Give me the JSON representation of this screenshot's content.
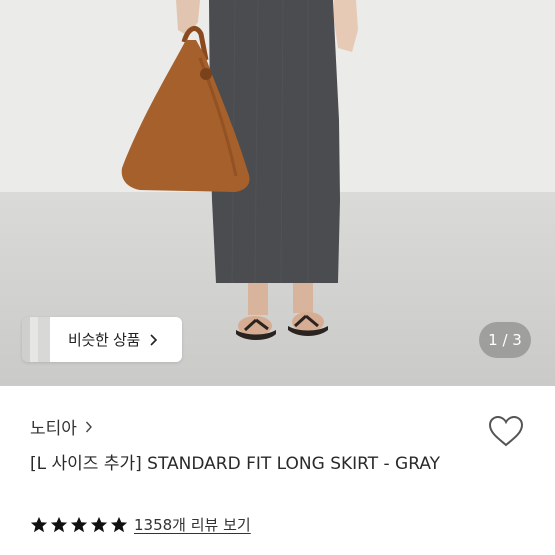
{
  "gallery": {
    "similar_button_label": "비슷한 상품",
    "counter": "1 / 3",
    "current_image": 1,
    "total_images": 3
  },
  "product": {
    "shop_name": "노티아",
    "title": "[L 사이즈 추가] STANDARD FIT LONG SKIRT - GRAY",
    "rating": 5,
    "review_link": "1358개 리뷰 보기"
  },
  "colors": {
    "star": "#111111",
    "heart_outline": "#555555",
    "counter_bg": "#787876"
  }
}
